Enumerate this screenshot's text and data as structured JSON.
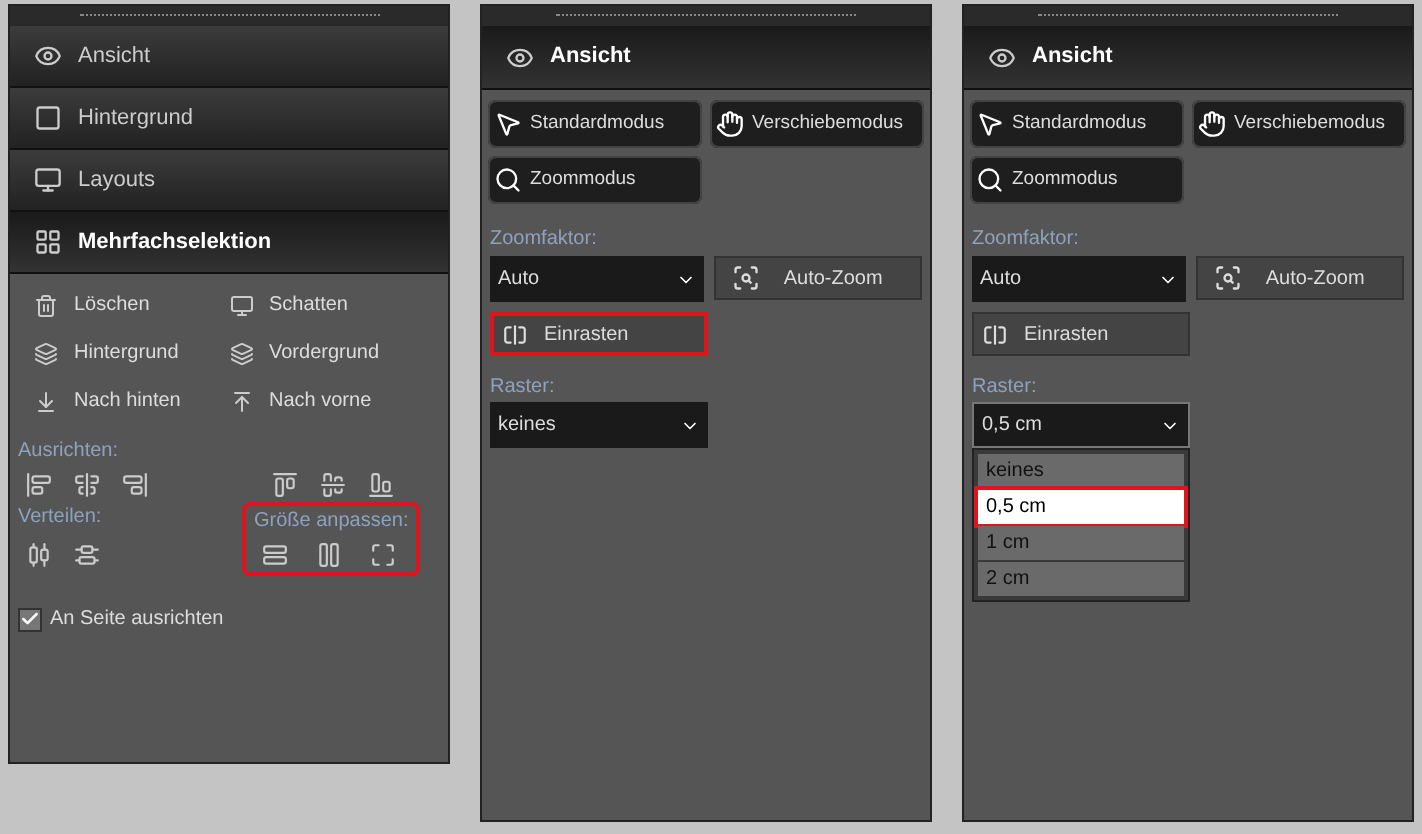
{
  "panels": [
    {
      "kind": "sections",
      "headers": [
        {
          "label": "Ansicht",
          "expanded": false
        },
        {
          "label": "Hintergrund",
          "expanded": false
        },
        {
          "label": "Layouts",
          "expanded": false
        },
        {
          "label": "Mehrfachselektion",
          "expanded": true
        }
      ],
      "actions": [
        "Löschen",
        "Schatten",
        "Hintergrund",
        "Vordergrund",
        "Nach hinten",
        "Nach vorne"
      ],
      "align_label": "Ausrichten:",
      "distribute_label": "Verteilen:",
      "resize": {
        "label": "Größe anpassen:",
        "highlighted": true
      },
      "checkbox": {
        "label": "An Seite ausrichten",
        "checked": true
      }
    },
    {
      "kind": "view",
      "header": "Ansicht",
      "modes": [
        "Standardmodus",
        "Verschiebemodus",
        "Zoommodus"
      ],
      "zoom_label": "Zoomfaktor:",
      "zoom_value": "Auto",
      "auto_zoom": "Auto-Zoom",
      "snap": {
        "label": "Einrasten",
        "highlighted": true
      },
      "raster_label": "Raster:",
      "raster_value": "keines",
      "open": false
    },
    {
      "kind": "view",
      "header": "Ansicht",
      "modes": [
        "Standardmodus",
        "Verschiebemodus",
        "Zoommodus"
      ],
      "zoom_label": "Zoomfaktor:",
      "zoom_value": "Auto",
      "auto_zoom": "Auto-Zoom",
      "snap": {
        "label": "Einrasten",
        "highlighted": false
      },
      "raster_label": "Raster:",
      "raster_value": "0,5 cm",
      "open": true,
      "options": [
        {
          "label": "keines",
          "selected": false
        },
        {
          "label": "0,5 cm",
          "selected": true
        },
        {
          "label": "1 cm",
          "selected": false
        },
        {
          "label": "2 cm",
          "selected": false
        }
      ]
    }
  ]
}
